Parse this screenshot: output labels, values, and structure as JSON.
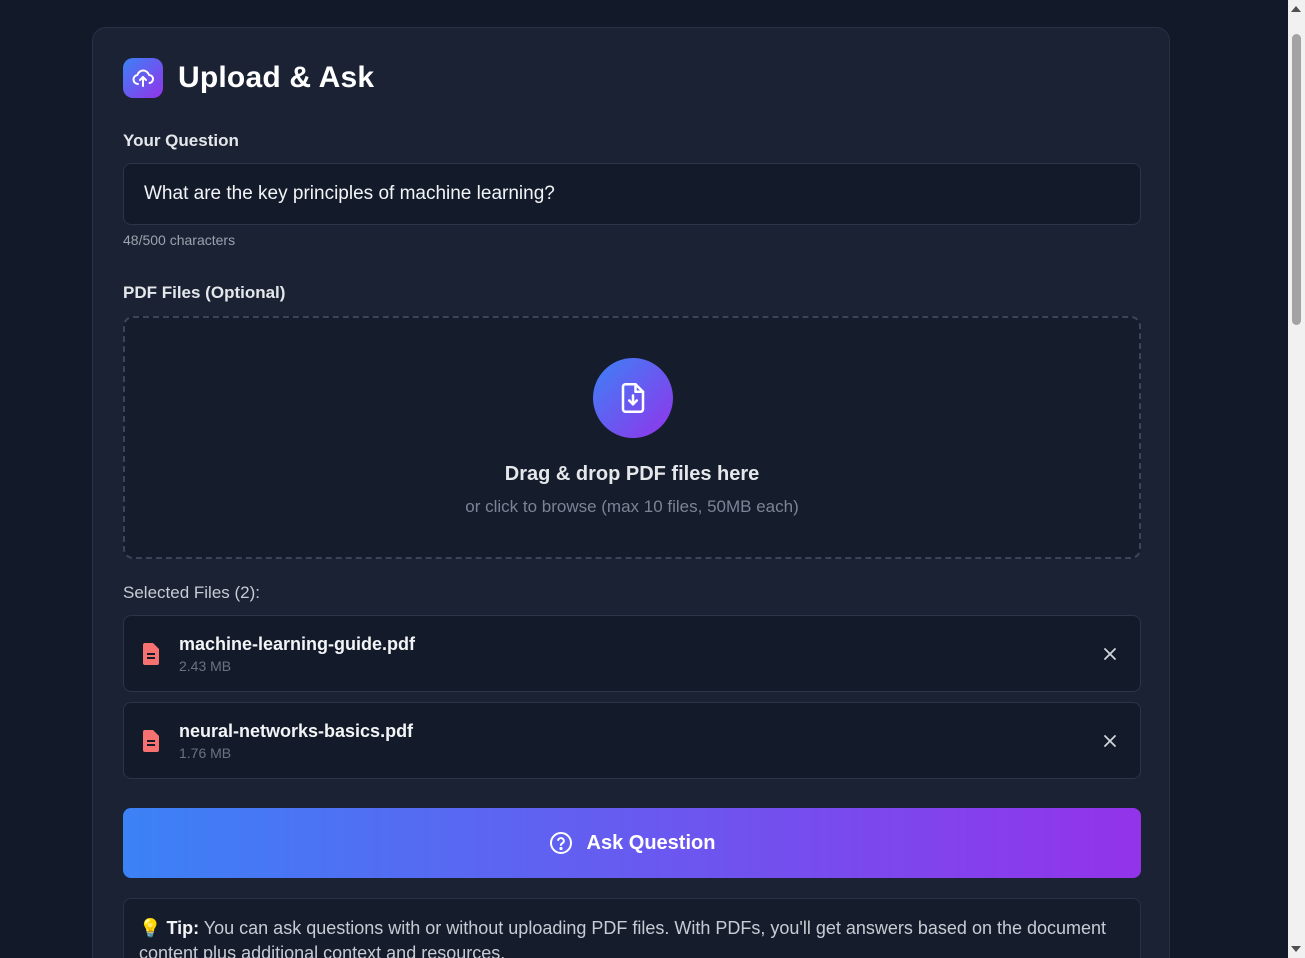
{
  "header": {
    "title": "Upload & Ask",
    "icon": "cloud-upload-icon"
  },
  "question": {
    "label": "Your Question",
    "value": "What are the key principles of machine learning?",
    "char_count": "48/500 characters"
  },
  "pdf": {
    "label": "PDF Files (Optional)",
    "drop_title": "Drag & drop PDF files here",
    "drop_subtitle": "or click to browse (max 10 files, 50MB each)",
    "drop_icon": "file-download-icon"
  },
  "files": {
    "label": "Selected Files (2):",
    "items": [
      {
        "name": "machine-learning-guide.pdf",
        "size": "2.43 MB"
      },
      {
        "name": "neural-networks-basics.pdf",
        "size": "1.76 MB"
      }
    ]
  },
  "ask_button": {
    "label": "Ask Question",
    "icon": "question-circle-icon"
  },
  "tip": {
    "icon": "💡",
    "strong": "Tip:",
    "text": " You can ask questions with or without uploading PDF files. With PDFs, you'll get answers based on the document content plus additional context and resources."
  },
  "colors": {
    "accent_start": "#3b82f6",
    "accent_end": "#9333ea",
    "file_icon": "#f87171",
    "card_bg": "#1a2233"
  }
}
